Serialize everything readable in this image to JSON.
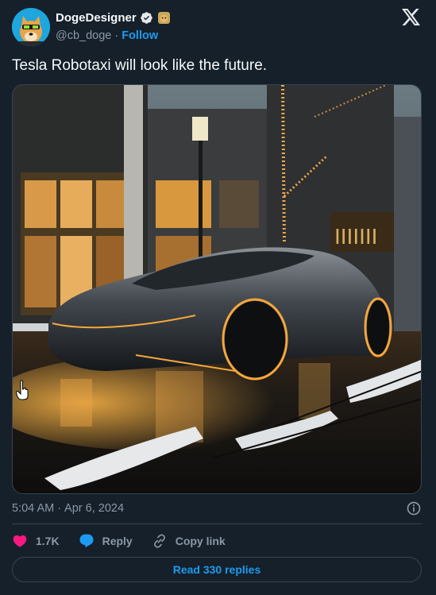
{
  "author": {
    "name": "DogeDesigner",
    "handle": "@cb_doge",
    "separator": "·",
    "follow_label": "Follow"
  },
  "tweet": {
    "text": "Tesla Robotaxi will look like the future."
  },
  "meta": {
    "time": "5:04 AM",
    "separator": "·",
    "date": "Apr 6, 2024"
  },
  "actions": {
    "likes": "1.7K",
    "reply_label": "Reply",
    "copy_link_label": "Copy link"
  },
  "read_replies_label": "Read 330 replies",
  "colors": {
    "background": "#15202b",
    "accent": "#1d9bf0",
    "like": "#f91880",
    "muted": "#8b98a5",
    "border": "#38444d"
  },
  "icons": [
    "verified-badge-icon",
    "affiliate-badge-icon",
    "x-logo-icon",
    "info-icon",
    "heart-icon",
    "reply-bubble-icon",
    "link-icon",
    "hand-cursor-icon"
  ]
}
